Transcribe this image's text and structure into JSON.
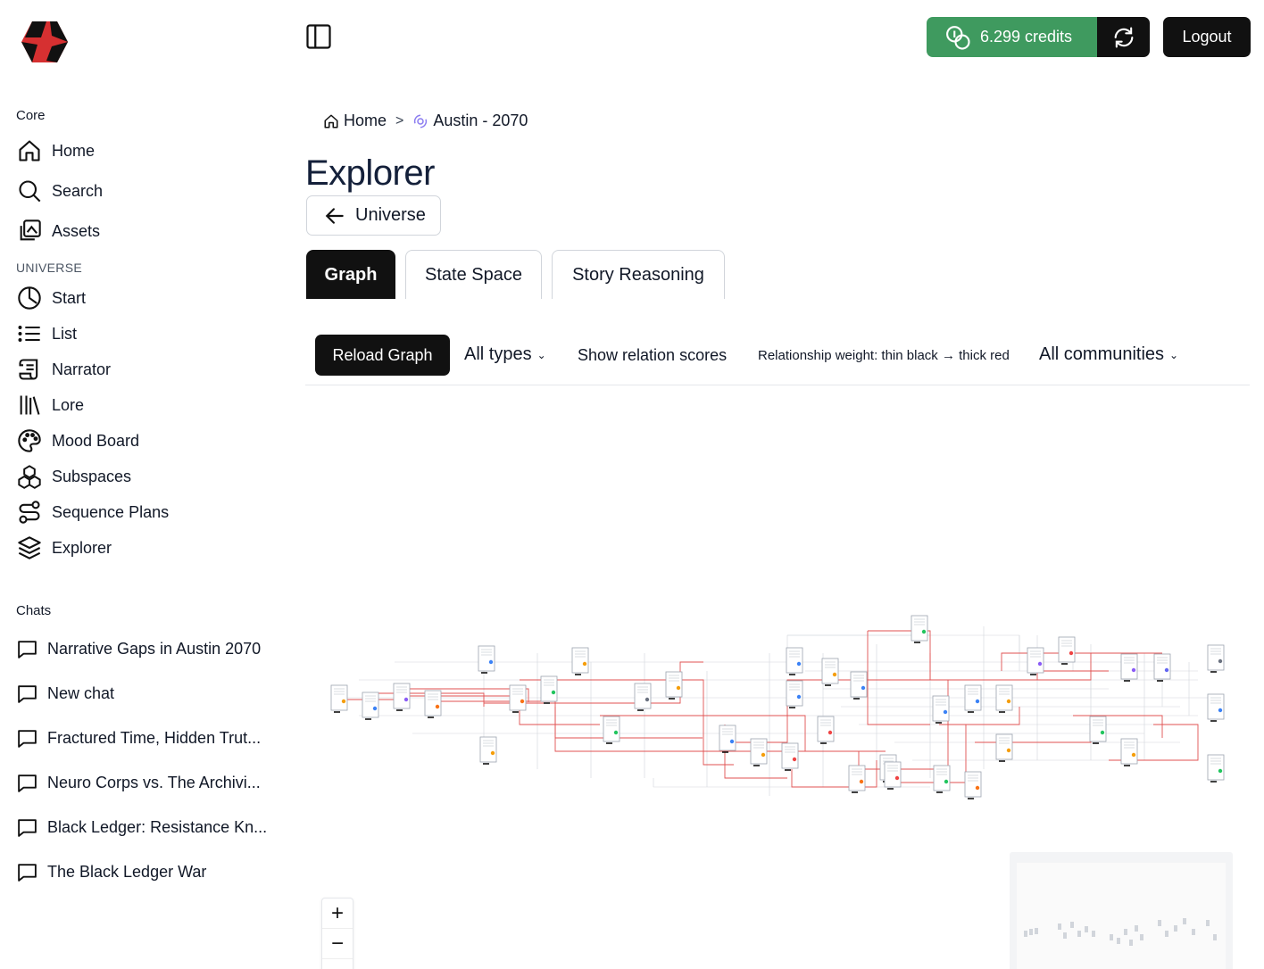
{
  "sidebar": {
    "core_label": "Core",
    "core_items": [
      {
        "label": "Home",
        "icon": "home-icon"
      },
      {
        "label": "Search",
        "icon": "search-icon"
      },
      {
        "label": "Assets",
        "icon": "assets-icon"
      }
    ],
    "universe_label": "UNIVERSE",
    "universe_items": [
      {
        "label": "Start",
        "icon": "clock-icon"
      },
      {
        "label": "List",
        "icon": "list-icon"
      },
      {
        "label": "Narrator",
        "icon": "scroll-icon"
      },
      {
        "label": "Lore",
        "icon": "library-icon"
      },
      {
        "label": "Mood Board",
        "icon": "palette-icon"
      },
      {
        "label": "Subspaces",
        "icon": "boxes-icon"
      },
      {
        "label": "Sequence Plans",
        "icon": "route-icon"
      },
      {
        "label": "Explorer",
        "icon": "layers-icon"
      }
    ],
    "chats_label": "Chats",
    "chats": [
      "Narrative Gaps in Austin 2070",
      "New chat",
      "Fractured Time, Hidden Trut...",
      "Neuro Corps vs. The Archivi...",
      "Black Ledger: Resistance Kn...",
      "The Black Ledger War"
    ]
  },
  "header": {
    "credits": "6.299 credits",
    "logout": "Logout"
  },
  "breadcrumb": {
    "home": "Home",
    "current": "Austin - 2070"
  },
  "page": {
    "title": "Explorer",
    "back_label": "Universe"
  },
  "tabs": [
    {
      "label": "Graph",
      "active": true
    },
    {
      "label": "State Space",
      "active": false
    },
    {
      "label": "Story Reasoning",
      "active": false
    }
  ],
  "toolbar": {
    "reload": "Reload Graph",
    "types": "All types",
    "relation_scores": "Show relation scores",
    "weight_legend": "Relationship weight: thin black → thick red",
    "communities": "All communities"
  },
  "zoom": {
    "in": "+",
    "out": "−"
  },
  "colors": {
    "accent_green": "#3f9a5f",
    "dark": "#111111",
    "edge_strong": "#e05252",
    "edge_weak": "#9ca3af"
  }
}
